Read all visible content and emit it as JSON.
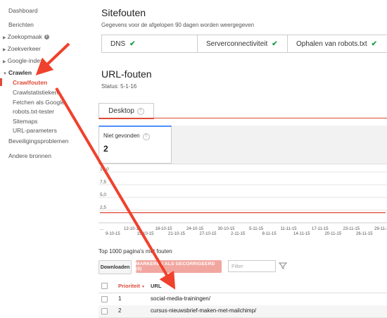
{
  "sidebar": {
    "items": [
      {
        "label": "Dashboard"
      },
      {
        "label": "Berichten"
      },
      {
        "label": "Zoekopmaak",
        "info": "i"
      },
      {
        "label": "Zoekverkeer"
      },
      {
        "label": "Google-index"
      },
      {
        "label": "Crawlen"
      },
      {
        "label": "Crawlfouten"
      },
      {
        "label": "Crawlstatistieken"
      },
      {
        "label": "Fetchen als Google"
      },
      {
        "label": "robots.txt-tester"
      },
      {
        "label": "Sitemaps"
      },
      {
        "label": "URL-parameters"
      },
      {
        "label": "Beveiligingsproblemen"
      },
      {
        "label": "Andere bronnen"
      }
    ]
  },
  "site_errors": {
    "title": "Sitefouten",
    "description": "Gegevens voor de afgelopen 90 dagen worden weergegeven",
    "cells": [
      {
        "label": "DNS",
        "status_icon": "check-icon"
      },
      {
        "label": "Serverconnectiviteit",
        "status_icon": "check-icon"
      },
      {
        "label": "Ophalen van robots.txt",
        "status_icon": "check-icon"
      }
    ],
    "status_color": "#1e9e4c"
  },
  "url_errors": {
    "title": "URL-fouten",
    "status": "Status: 5-1-16",
    "tab": "Desktop",
    "tab_help": "?",
    "metric_label": "Niet gevonden",
    "metric_help": "?",
    "metric_value": "2"
  },
  "chart_data": {
    "type": "line",
    "y_ticks": [
      "10,0",
      "7,5",
      "5,0",
      "2,5"
    ],
    "ylim": [
      0,
      10
    ],
    "x_ticks_upper": [
      "...",
      "12-10-15",
      "18-10-15",
      "24-10-15",
      "30-10-15",
      "5-11-15",
      "11-11-15",
      "17-11-15",
      "23-11-15",
      "29-11-15"
    ],
    "x_ticks_lower": [
      "9-10-15",
      "15-10-15",
      "21-10-15",
      "27-10-15",
      "2-11-15",
      "8-11-15",
      "14-11-15",
      "20-11-15",
      "26-11-15",
      "2-12"
    ],
    "series": [
      {
        "values": [
          2,
          2,
          2,
          2,
          2,
          2,
          2,
          2,
          2,
          2,
          2,
          2,
          2,
          2,
          2,
          2,
          2,
          2,
          2,
          2
        ]
      }
    ],
    "line_color": "#dd4b39",
    "grid": true
  },
  "table": {
    "title": "Top 1000 pagina's met fouten",
    "download_label": "Downloaden",
    "mark_label": "MARKEREN ALS GECORRIGEERD (0)",
    "filter_placeholder": "Filter",
    "headers": {
      "priority": "Prioriteit",
      "priority_sort": "▼",
      "url": "URL"
    },
    "rows": [
      {
        "priority": "1",
        "url": "social-media-trainingen/"
      },
      {
        "priority": "2",
        "url": "cursus-nieuwsbrief-maken-met-mailchimp/"
      }
    ]
  },
  "colors": {
    "accent": "#dd4b39",
    "annotation_arrow": "#f0412c"
  }
}
